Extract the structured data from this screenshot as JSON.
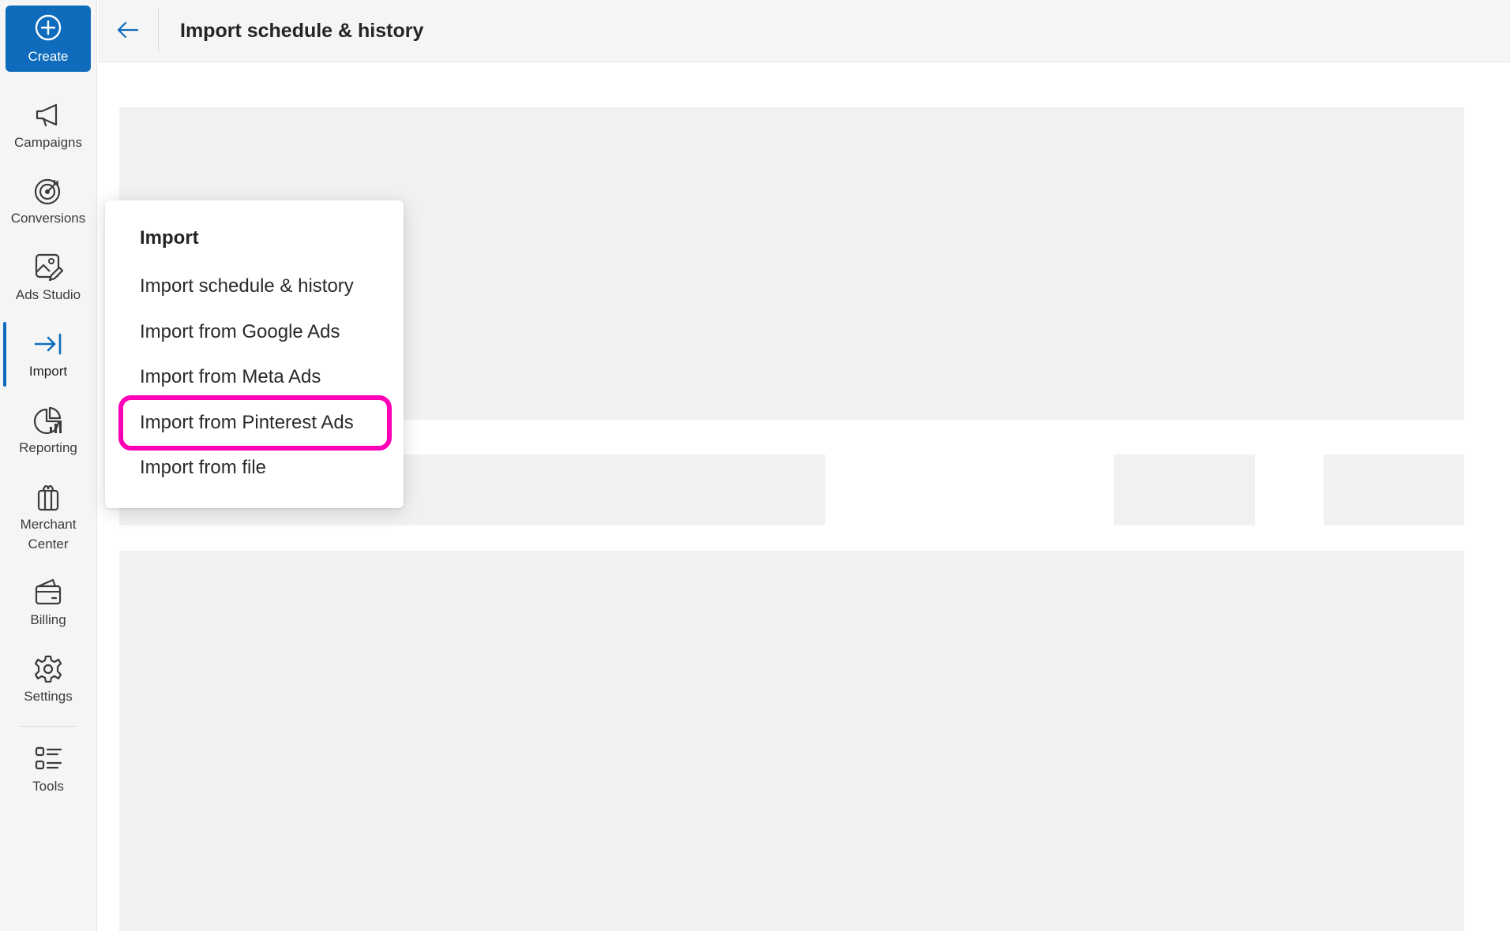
{
  "header": {
    "back_label": "Back",
    "title": "Import schedule & history"
  },
  "rail": {
    "create_label": "Create",
    "items": [
      {
        "label": "Campaigns",
        "icon": "megaphone-icon"
      },
      {
        "label": "Conversions",
        "icon": "target-icon"
      },
      {
        "label": "Ads Studio",
        "icon": "image-edit-icon"
      },
      {
        "label": "Import",
        "icon": "arrow-import-icon",
        "active": true
      },
      {
        "label": "Reporting",
        "icon": "chart-pie-icon"
      },
      {
        "label": "Merchant Center",
        "icon": "gift-icon"
      },
      {
        "label": "Billing",
        "icon": "wallet-icon"
      },
      {
        "label": "Settings",
        "icon": "gear-icon"
      },
      {
        "label": "Tools",
        "icon": "list-icon"
      }
    ]
  },
  "flyout": {
    "title": "Import",
    "items": [
      {
        "label": "Import schedule & history"
      },
      {
        "label": "Import from Google Ads"
      },
      {
        "label": "Import from Meta Ads"
      },
      {
        "label": "Import from Pinterest Ads",
        "highlighted": true
      },
      {
        "label": "Import from file"
      }
    ]
  },
  "colors": {
    "accent": "#0f6cbd",
    "highlight": "#ff00b8",
    "skeleton": "#f2f1f0",
    "rail_background": "#f5f5f5"
  }
}
